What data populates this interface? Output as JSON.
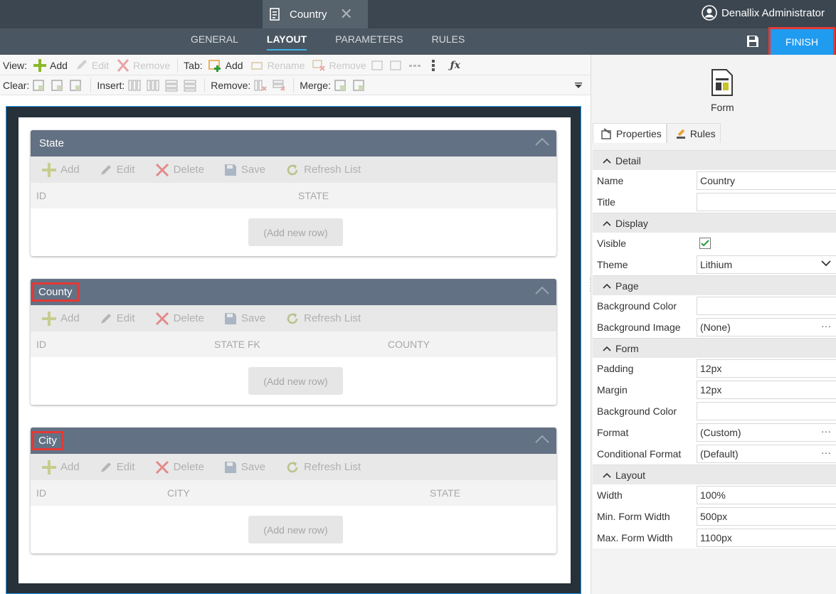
{
  "window": {
    "tab_title": "Country",
    "user": "Denallix Administrator"
  },
  "nav": {
    "tabs": [
      "GENERAL",
      "LAYOUT",
      "PARAMETERS",
      "RULES"
    ],
    "active": "LAYOUT",
    "finish": "FINISH"
  },
  "toolbar": {
    "row1": {
      "view_label": "View:",
      "view_add": "Add",
      "view_edit": "Edit",
      "view_remove": "Remove",
      "tab_label": "Tab:",
      "tab_add": "Add",
      "tab_rename": "Rename",
      "tab_remove": "Remove"
    },
    "row2": {
      "clear_label": "Clear:",
      "insert_label": "Insert:",
      "remove_label": "Remove:",
      "merge_label": "Merge:"
    }
  },
  "panels": [
    {
      "title": "State",
      "columns": [
        "ID",
        "STATE"
      ],
      "add_row": "(Add new row)"
    },
    {
      "title": "County",
      "columns": [
        "ID",
        "STATE FK",
        "COUNTY"
      ],
      "add_row": "(Add new row)"
    },
    {
      "title": "City",
      "columns": [
        "ID",
        "CITY",
        "STATE"
      ],
      "add_row": "(Add new row)"
    }
  ],
  "panel_toolbar": {
    "add": "Add",
    "edit": "Edit",
    "delete": "Delete",
    "save": "Save",
    "refresh": "Refresh List"
  },
  "sidebar": {
    "object_label": "Form",
    "tabs": [
      "Properties",
      "Rules"
    ],
    "sections": [
      {
        "title": "Detail",
        "rows": [
          {
            "k": "Name",
            "v": "Country"
          },
          {
            "k": "Title",
            "v": ""
          }
        ]
      },
      {
        "title": "Display",
        "rows": [
          {
            "k": "Visible",
            "v": "checked"
          },
          {
            "k": "Theme",
            "v": "Lithium"
          }
        ]
      },
      {
        "title": "Page",
        "rows": [
          {
            "k": "Background Color",
            "v": ""
          },
          {
            "k": "Background Image",
            "v": "(None)"
          }
        ]
      },
      {
        "title": "Form",
        "rows": [
          {
            "k": "Padding",
            "v": "12px"
          },
          {
            "k": "Margin",
            "v": "12px"
          },
          {
            "k": "Background Color",
            "v": ""
          },
          {
            "k": "Format",
            "v": "(Custom)"
          },
          {
            "k": "Conditional Format",
            "v": "(Default)"
          }
        ]
      },
      {
        "title": "Layout",
        "rows": [
          {
            "k": "Width",
            "v": "100%"
          },
          {
            "k": "Min. Form Width",
            "v": "500px"
          },
          {
            "k": "Max. Form Width",
            "v": "1100px"
          }
        ]
      }
    ]
  },
  "colors": {
    "accent": "#1f9cf0",
    "highlight": "#e53935",
    "panel_header": "#637184",
    "topbar": "#3b4650"
  }
}
